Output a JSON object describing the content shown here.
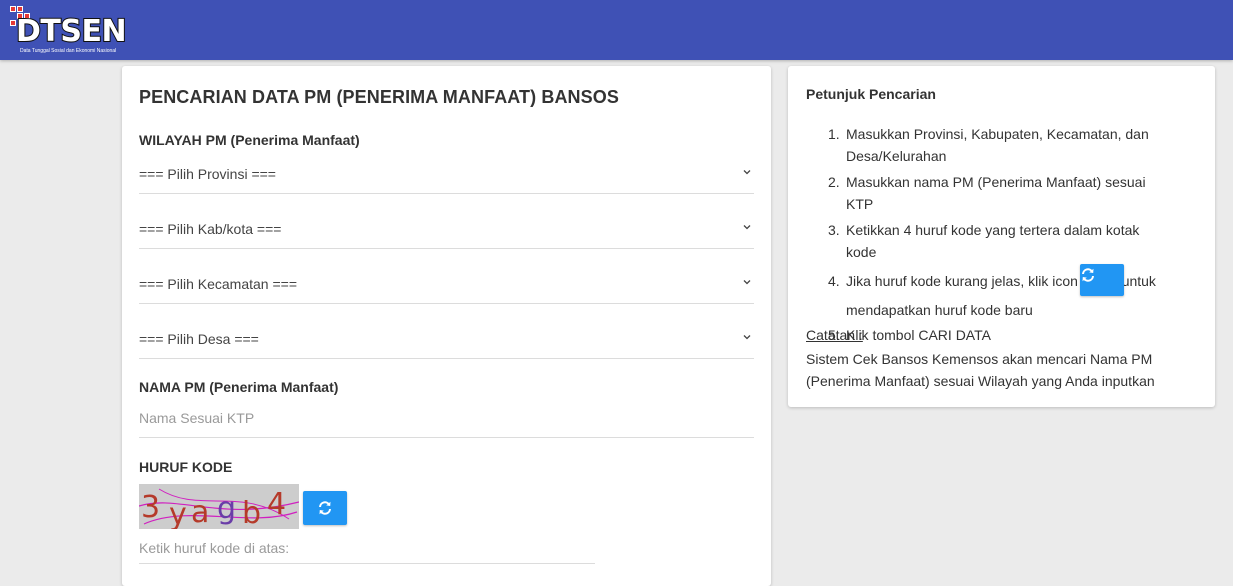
{
  "brand": {
    "name": "DTSEN",
    "tagline": "Data Tunggal Sosial dan Ekonomi Nasional",
    "accent_color": "#3f51b5",
    "logo_square_color": "#e53935"
  },
  "form": {
    "title": "PENCARIAN DATA PM (PENERIMA MANFAAT) BANSOS",
    "wilayah_label": "WILAYAH PM (Penerima Manfaat)",
    "provinsi_selected": "=== Pilih Provinsi ===",
    "kabkota_selected": "=== Pilih Kab/kota ===",
    "kecamatan_selected": "=== Pilih Kecamatan ===",
    "desa_selected": "=== Pilih Desa ===",
    "nama_label": "NAMA PM (Penerima Manfaat)",
    "nama_placeholder": "Nama Sesuai KTP",
    "nama_value": "",
    "kode_label": "HURUF KODE",
    "captcha_text": "3yagb4",
    "kode_placeholder": "Ketik huruf kode di atas:",
    "kode_value": "",
    "refresh_icon": "refresh-icon",
    "button_color": "#2196f3"
  },
  "help": {
    "title": "Petunjuk Pencarian",
    "steps": [
      {
        "num": "1.",
        "text": "Masukkan Provinsi, Kabupaten, Kecamatan, dan Desa/Kelurahan"
      },
      {
        "num": "2.",
        "text": "Masukkan nama PM (Penerima Manfaat) sesuai KTP"
      },
      {
        "num": "3.",
        "text": "Ketikkan 4 huruf kode yang tertera dalam kotak kode"
      },
      {
        "num": "4.",
        "text_before": "Jika huruf kode kurang jelas, klik icon",
        "text_after": "untuk mendapatkan huruf kode baru"
      },
      {
        "num": "5.",
        "text": "Klik tombol CARI DATA"
      }
    ],
    "note_label": "Catatan :",
    "note_text": "Sistem Cek Bansos Kemensos akan mencari Nama PM (Penerima Manfaat) sesuai Wilayah yang Anda inputkan"
  }
}
